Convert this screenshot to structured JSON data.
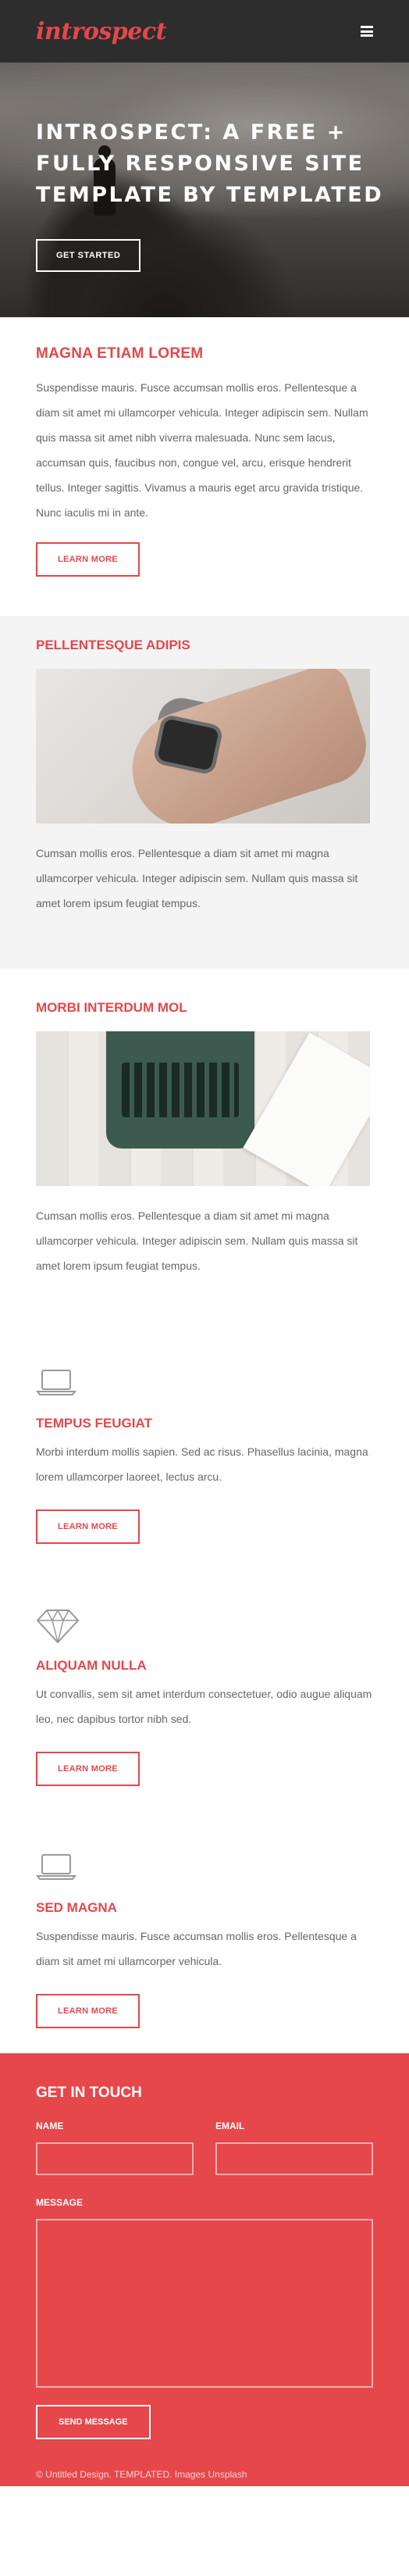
{
  "header": {
    "logo": "introspect",
    "menu_icon": "hamburger-icon"
  },
  "hero": {
    "title": "INTROSPECT: A FREE + FULLY RESPONSIVE SITE TEMPLATE BY TEMPLATED",
    "button": "GET STARTED"
  },
  "section1": {
    "title": "MAGNA ETIAM LOREM",
    "text": "Suspendisse mauris. Fusce accumsan mollis eros. Pellentesque a diam sit amet mi ullamcorper vehicula. Integer adipiscin sem. Nullam quis massa sit amet nibh viverra malesuada. Nunc sem lacus, accumsan quis, faucibus non, congue vel, arcu, erisque hendrerit tellus. Integer sagittis. Vivamus a mauris eget arcu gravida tristique. Nunc iaculis mi in ante.",
    "button": "LEARN MORE"
  },
  "section2": {
    "title": "PELLENTESQUE ADIPIS",
    "text": "Cumsan mollis eros. Pellentesque a diam sit amet mi magna ullamcorper vehicula. Integer adipiscin sem. Nullam quis massa sit amet lorem ipsum feugiat tempus."
  },
  "section3": {
    "title": "MORBI INTERDUM MOL",
    "text": "Cumsan mollis eros. Pellentesque a diam sit amet mi magna ullamcorper vehicula. Integer adipiscin sem. Nullam quis massa sit amet lorem ipsum feugiat tempus."
  },
  "features": [
    {
      "icon": "laptop-icon",
      "title": "TEMPUS FEUGIAT",
      "text": "Morbi interdum mollis sapien. Sed ac risus. Phasellus lacinia, magna lorem ullamcorper laoreet, lectus arcu.",
      "button": "LEARN MORE"
    },
    {
      "icon": "diamond-icon",
      "title": "ALIQUAM NULLA",
      "text": "Ut convallis, sem sit amet interdum consectetuer, odio augue aliquam leo, nec dapibus tortor nibh sed.",
      "button": "LEARN MORE"
    },
    {
      "icon": "laptop-icon",
      "title": "SED MAGNA",
      "text": "Suspendisse mauris. Fusce accumsan mollis eros. Pellentesque a diam sit amet mi ullamcorper vehicula.",
      "button": "LEARN MORE"
    }
  ],
  "contact": {
    "title": "GET IN TOUCH",
    "name_label": "NAME",
    "email_label": "EMAIL",
    "message_label": "MESSAGE",
    "name_value": "",
    "email_value": "",
    "message_value": "",
    "button": "SEND MESSAGE",
    "copyright": "© Untitled Design. TEMPLATED. Images Unsplash"
  },
  "colors": {
    "accent": "#e5474b",
    "header_bg": "#2d2d2d",
    "gray_bg": "#f4f4f4"
  }
}
